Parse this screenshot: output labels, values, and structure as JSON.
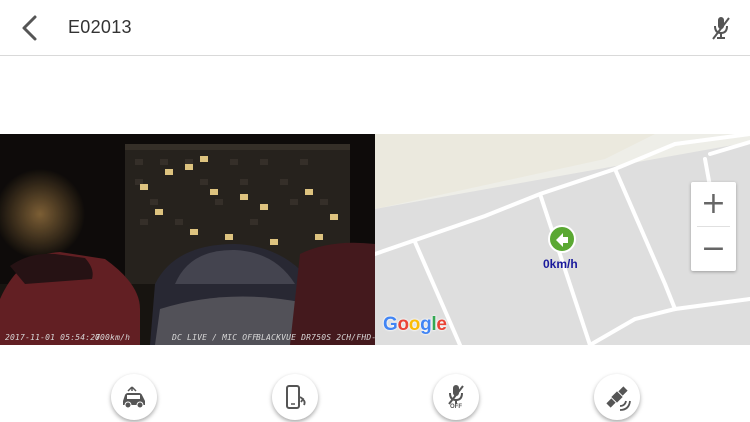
{
  "header": {
    "title": "E02013",
    "back_icon": "chevron-left-icon",
    "mic_icon": "mic-off-icon"
  },
  "video": {
    "osd_datetime": "2017-11-01 05:54:27",
    "osd_speed": "000km/h",
    "osd_status": "DC LIVE / MIC OFF",
    "osd_device": "BLACKVUE DR750S 2CH/FHD-FHD"
  },
  "map": {
    "speed_label": "0km/h",
    "zoom_in_label": "+",
    "zoom_out_label": "−",
    "attribution": {
      "letters": [
        "G",
        "o",
        "o",
        "g",
        "l",
        "e"
      ],
      "colors": [
        "#4285F4",
        "#EA4335",
        "#FBBC05",
        "#4285F4",
        "#34A853",
        "#EA4335"
      ]
    },
    "marker_color": "#5aa832"
  },
  "actions": [
    {
      "icon": "car-event-icon"
    },
    {
      "icon": "phone-rotate-icon"
    },
    {
      "icon": "mic-off-icon",
      "label": "OFF"
    },
    {
      "icon": "satellite-icon"
    }
  ]
}
